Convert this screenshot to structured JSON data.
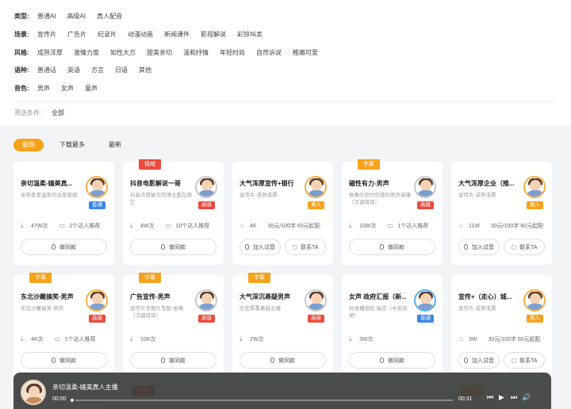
{
  "filters": {
    "type": {
      "label": "类型:",
      "options": [
        "普通AI",
        "高级AI",
        "真人配音"
      ]
    },
    "scene": {
      "label": "场景:",
      "options": [
        "宣传片",
        "广告片",
        "纪录片",
        "动漫动画",
        "新闻课件",
        "影视解说",
        "彩铃叫卖"
      ]
    },
    "style": {
      "label": "风格:",
      "options": [
        "成熟浑厚",
        "激情力度",
        "知性大方",
        "甜美亲切",
        "温和抒情",
        "年轻时尚",
        "自然诉说",
        "稚嫩可爱"
      ]
    },
    "language": {
      "label": "语种:",
      "options": [
        "普通话",
        "英语",
        "方言",
        "日语",
        "其他"
      ]
    },
    "voice": {
      "label": "音色:",
      "options": [
        "男声",
        "女声",
        "童声"
      ]
    },
    "selected": {
      "label": "筛选条件:",
      "value": "全部"
    }
  },
  "sort_tabs": [
    "最热",
    "下载最多",
    "最新"
  ],
  "cards": [
    {
      "title": "亲切温柔-嫱美真...",
      "desc": "亲笑爱爱温柔的淡爱姐姐",
      "badge": "普通",
      "badge_color": "blue",
      "stat1": "47W次",
      "stat2": "2个达人推荐",
      "button": "做同款"
    },
    {
      "tag": "情绪",
      "tag_color": "red",
      "title": "抖音电影解说一哥",
      "desc": "抖音点赞破万的博主都在用它",
      "badge": "高级",
      "badge_color": "red",
      "stat1": "4W次",
      "stat2": "10个达人推荐",
      "button": "做同款"
    },
    {
      "title": "大气浑厚宣传+银行",
      "desc": "宣传片·成熟浑厚",
      "badge": "真人",
      "badge_color": "orange",
      "stat1": "4K",
      "stat2": "30元/100字 60元起配",
      "button1": "加入试音",
      "button2": "联系TA"
    },
    {
      "tag": "字幕",
      "tag_color": "orange",
      "title": "磁性有力-男声",
      "desc": "故事历史时空感的男声音播（汉调双译）",
      "badge": "高级",
      "badge_color": "red",
      "stat1": "10W次",
      "stat2": "1个达人推荐",
      "button": "做同款"
    },
    {
      "title": "大气浑厚企业（推...",
      "desc": "宣传片·成熟浑厚",
      "badge": "真人",
      "badge_color": "orange",
      "stat1": "11W",
      "stat2": "30元/100字 60元起配",
      "button1": "加入试音",
      "button2": "联系TA"
    },
    {
      "tag": "字幕",
      "tag_color": "orange",
      "title": "东北沙雕搞笑-男声",
      "desc": "东北沙雕搞笑-男声",
      "badge": "高级",
      "badge_color": "red",
      "stat1": "4K次",
      "stat2": "1个达人推荐",
      "button": "做同款"
    },
    {
      "tag": "字幕",
      "tag_color": "orange",
      "title": "广告宣传-男声",
      "desc": "宣传片专题片专配-省略（汉调双译）",
      "badge": "高级",
      "badge_color": "red",
      "stat1": "10K次",
      "button": "做同款"
    },
    {
      "tag": "字幕",
      "tag_color": "orange",
      "title": "大气深沉悬疑男声",
      "desc": "历史厚重悬疑主播",
      "badge": "高级",
      "badge_color": "red",
      "stat1": "2W次",
      "button": "做同款"
    },
    {
      "title": "女声 政府汇报（新...",
      "desc": "标准播音腔-端庄（中英双语）",
      "badge": "普通",
      "badge_color": "blue",
      "stat1": "3W次",
      "button": "做同款"
    },
    {
      "title": "宣传+（走心）城...",
      "desc": "宣传片·成熟浑厚",
      "badge": "真人",
      "badge_color": "orange",
      "stat1": "3W",
      "stat2": "30元/100字 60元起配",
      "button1": "加入试音",
      "button2": "联系TA"
    }
  ],
  "peek_tags": [
    {
      "text": "情绪",
      "color": "red"
    },
    {
      "text": "字幕",
      "color": "orange"
    }
  ],
  "player": {
    "title": "亲切温柔-嫱美真人主播",
    "current": "00:00",
    "total": "00:31",
    "progress": 0
  }
}
